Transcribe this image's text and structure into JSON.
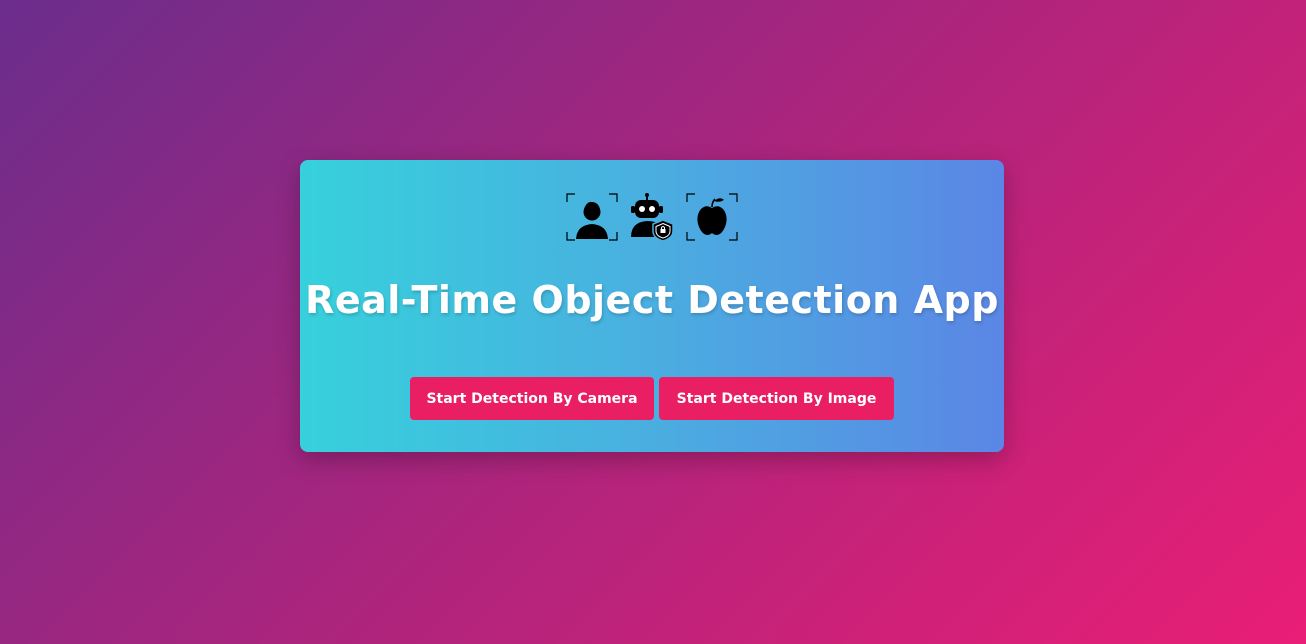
{
  "card": {
    "icons": [
      "face-scan-icon",
      "robot-shield-icon",
      "apple-scan-icon"
    ],
    "title": "Real-Time Object Detection App",
    "buttons": {
      "camera_label": "Start Detection By Camera",
      "image_label": "Start Detection By Image"
    }
  },
  "colors": {
    "background_start": "#6b2d8c",
    "background_end": "#e91e77",
    "card_start": "#36d1dc",
    "card_end": "#5b86e5",
    "button": "#e91e63",
    "text": "#ffffff"
  }
}
